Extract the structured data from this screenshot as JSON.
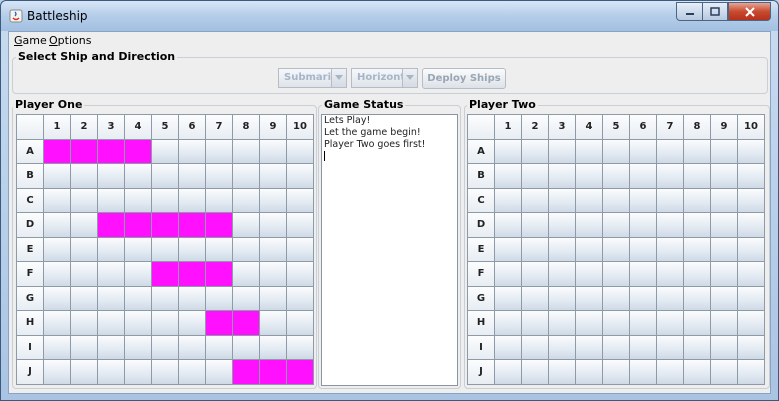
{
  "window": {
    "title": "Battleship",
    "colors": {
      "ship": "#ff11ff",
      "cell": "#dfe7f0"
    }
  },
  "menu": [
    {
      "label": "Game",
      "mnemonic": "G",
      "rest": "ame"
    },
    {
      "label": "Options",
      "mnemonic": "O",
      "rest": "ptions"
    }
  ],
  "controls": {
    "group_title": "Select Ship and Direction",
    "ship_select": "Submarine",
    "direction_select": "Horizontal",
    "deploy_label": "Deploy Ships"
  },
  "columns": [
    "1",
    "2",
    "3",
    "4",
    "5",
    "6",
    "7",
    "8",
    "9",
    "10"
  ],
  "rows": [
    "A",
    "B",
    "C",
    "D",
    "E",
    "F",
    "G",
    "H",
    "I",
    "J"
  ],
  "player_one": {
    "title": "Player One",
    "ships": [
      [
        0,
        0
      ],
      [
        0,
        1
      ],
      [
        0,
        2
      ],
      [
        0,
        3
      ],
      [
        3,
        2
      ],
      [
        3,
        3
      ],
      [
        3,
        4
      ],
      [
        3,
        5
      ],
      [
        3,
        6
      ],
      [
        5,
        4
      ],
      [
        5,
        5
      ],
      [
        5,
        6
      ],
      [
        7,
        6
      ],
      [
        7,
        7
      ],
      [
        9,
        7
      ],
      [
        9,
        8
      ],
      [
        9,
        9
      ]
    ]
  },
  "player_two": {
    "title": "Player Two",
    "ships": []
  },
  "game_status": {
    "title": "Game Status",
    "lines": [
      "Lets Play!",
      "Let the game begin!",
      "Player Two goes first!"
    ]
  }
}
